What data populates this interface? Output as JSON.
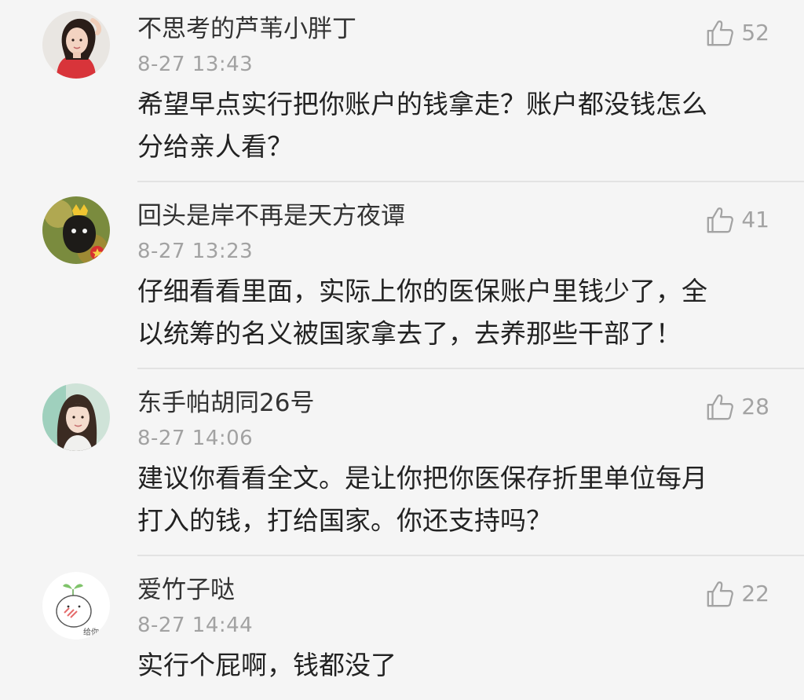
{
  "comments": [
    {
      "username": "不思考的芦苇小胖丁",
      "time": "8-27 13:43",
      "likes": "52",
      "text_lines": [
        "希望早点实行把你账户的钱拿走？账户都没钱怎么",
        "分给亲人看？"
      ],
      "avatar_icon": "avatar-woman-red-top"
    },
    {
      "username": "回头是岸不再是天方夜谭",
      "time": "8-27 13:23",
      "likes": "41",
      "text_lines": [
        "仔细看看里面，实际上你的医保账户里钱少了，全",
        "以统筹的名义被国家拿去了，去养那些干部了！"
      ],
      "avatar_icon": "avatar-cartoon-crown"
    },
    {
      "username": "东手帕胡同26号",
      "time": "8-27 14:06",
      "likes": "28",
      "text_lines": [
        "建议你看看全文。是让你把你医保存折里单位每月",
        "打入的钱，打给国家。你还支持吗？"
      ],
      "avatar_icon": "avatar-woman-long-hair"
    },
    {
      "username": "爱竹子哒",
      "time": "8-27 14:44",
      "likes": "22",
      "text_lines": [
        "实行个屁啊，钱都没了"
      ],
      "avatar_icon": "avatar-doodle-sprout"
    }
  ],
  "like_icon": "thumbs-up-icon",
  "avatar_doodle_caption": "给你",
  "colors": {
    "background": "#f5f5f5",
    "username": "#333333",
    "timestamp": "#a2a2a2",
    "body": "#222222",
    "like": "#a3a3a3",
    "divider": "#e3e3e3"
  }
}
